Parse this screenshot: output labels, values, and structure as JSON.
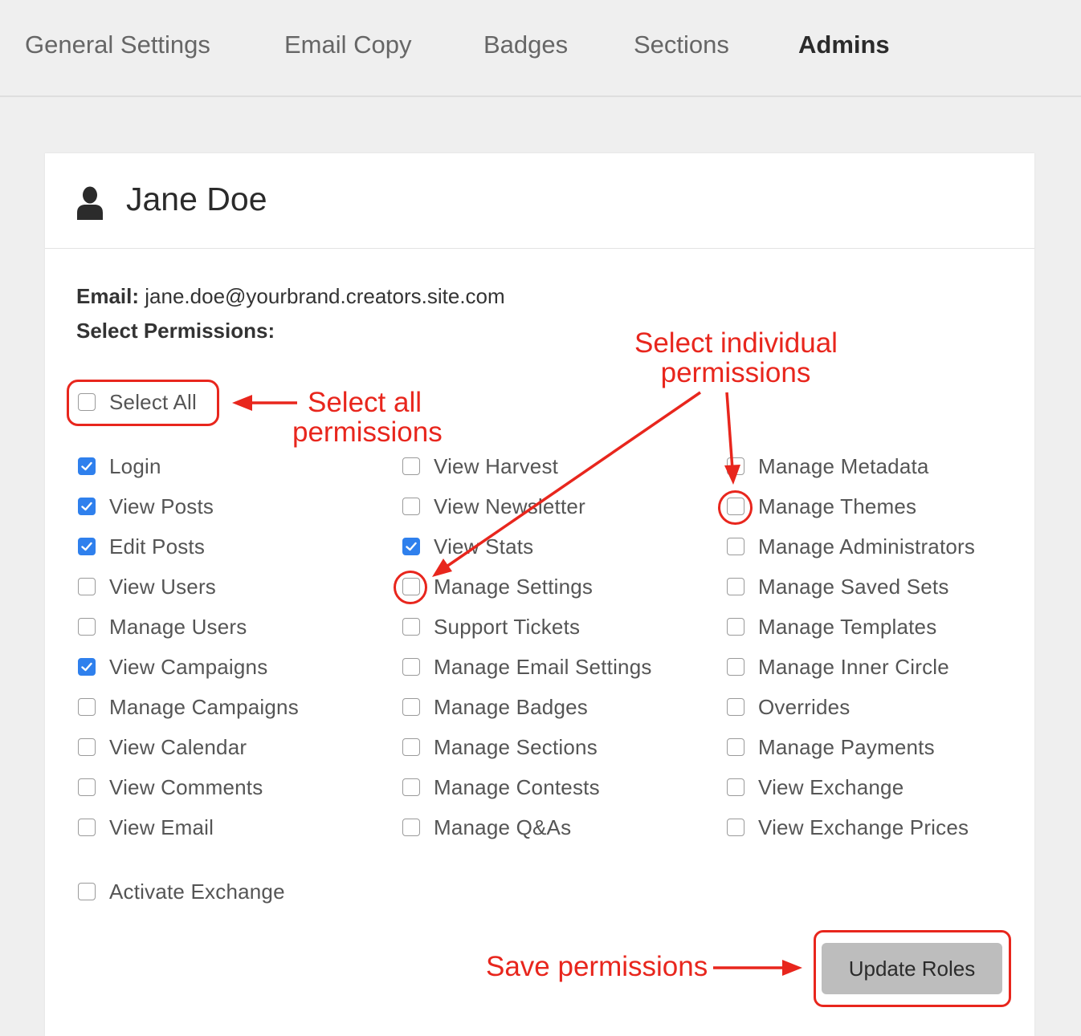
{
  "tabs": [
    {
      "label": "General Settings",
      "active": false
    },
    {
      "label": "Email Copy",
      "active": false
    },
    {
      "label": "Badges",
      "active": false
    },
    {
      "label": "Sections",
      "active": false
    },
    {
      "label": "Admins",
      "active": true
    }
  ],
  "user": {
    "name": "Jane Doe",
    "icon": "user-icon"
  },
  "email": {
    "label": "Email:",
    "value": "jane.doe@yourbrand.creators.site.com"
  },
  "permissions_title": "Select Permissions:",
  "select_all": {
    "label": "Select All",
    "checked": false
  },
  "permissions": {
    "column1": [
      {
        "label": "Login",
        "checked": true
      },
      {
        "label": "View Posts",
        "checked": true
      },
      {
        "label": "Edit Posts",
        "checked": true
      },
      {
        "label": "View Users",
        "checked": false
      },
      {
        "label": "Manage Users",
        "checked": false
      },
      {
        "label": "View Campaigns",
        "checked": true
      },
      {
        "label": "Manage Campaigns",
        "checked": false
      },
      {
        "label": "View Calendar",
        "checked": false
      },
      {
        "label": "View Comments",
        "checked": false
      },
      {
        "label": "View Email",
        "checked": false
      }
    ],
    "column2": [
      {
        "label": "View Harvest",
        "checked": false
      },
      {
        "label": "View Newsletter",
        "checked": false
      },
      {
        "label": "View Stats",
        "checked": true
      },
      {
        "label": "Manage Settings",
        "checked": false
      },
      {
        "label": "Support Tickets",
        "checked": false
      },
      {
        "label": "Manage Email Settings",
        "checked": false
      },
      {
        "label": "Manage Badges",
        "checked": false
      },
      {
        "label": "Manage Sections",
        "checked": false
      },
      {
        "label": "Manage Contests",
        "checked": false
      },
      {
        "label": "Manage Q&As",
        "checked": false
      }
    ],
    "column3": [
      {
        "label": "Manage Metadata",
        "checked": false
      },
      {
        "label": "Manage Themes",
        "checked": false
      },
      {
        "label": "Manage Administrators",
        "checked": false
      },
      {
        "label": "Manage Saved Sets",
        "checked": false
      },
      {
        "label": "Manage Templates",
        "checked": false
      },
      {
        "label": "Manage Inner Circle",
        "checked": false
      },
      {
        "label": "Overrides",
        "checked": false
      },
      {
        "label": "Manage Payments",
        "checked": false
      },
      {
        "label": "View Exchange",
        "checked": false
      },
      {
        "label": "View Exchange Prices",
        "checked": false
      }
    ],
    "extra": [
      {
        "label": "Activate Exchange",
        "checked": false
      }
    ]
  },
  "update_button": {
    "label": "Update Roles"
  },
  "annotations": {
    "select_all": [
      "Select all",
      "permissions"
    ],
    "individual": [
      "Select individual",
      "permissions"
    ],
    "save": "Save permissions",
    "color": "#e8261d"
  },
  "colors": {
    "checked": "#2f80ed",
    "button": "#bdbdbd",
    "background": "#efefef"
  }
}
